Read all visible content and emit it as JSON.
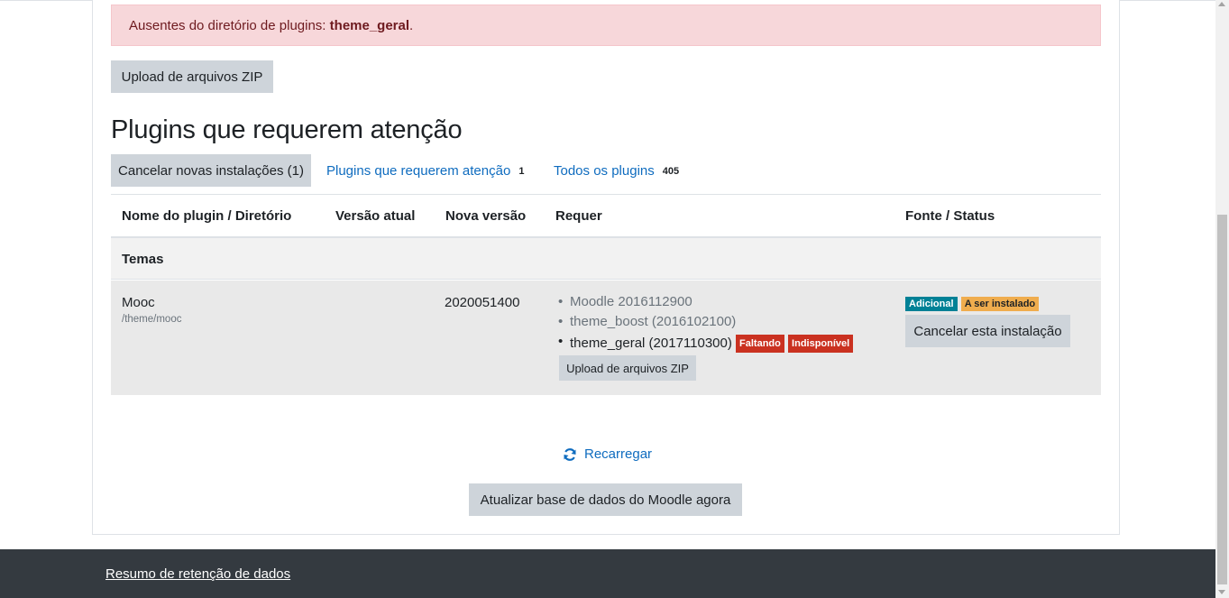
{
  "alert": {
    "text": "Ausentes do diretório de plugins: ",
    "plugin": "theme_geral",
    "suffix": "."
  },
  "upload_zip_label": "Upload de arquivos ZIP",
  "heading": "Plugins que requerem atenção",
  "cancel_new_label": "Cancelar novas instalações (1)",
  "nav": {
    "attention_label": "Plugins que requerem atenção",
    "attention_count": "1",
    "all_label": "Todos os plugins",
    "all_count": "405"
  },
  "table": {
    "headers": [
      "Nome do plugin / Diretório",
      "Versão atual",
      "Nova versão",
      "Requer",
      "Fonte / Status"
    ],
    "group": "Temas",
    "row": {
      "name": "Mooc",
      "dir": "/theme/mooc",
      "current_version": "",
      "new_version": "2020051400",
      "requires": [
        {
          "text": "Moodle 2016112900"
        },
        {
          "text": "theme_boost (2016102100)"
        },
        {
          "text": "theme_geral (2017110300)",
          "badges": [
            "Faltando",
            "Indisponível"
          ]
        }
      ],
      "upload_label": "Upload de arquivos ZIP",
      "status_tags": [
        "Adicional",
        "A ser instalado"
      ],
      "cancel_label": "Cancelar esta instalação"
    }
  },
  "reload_label": "Recarregar",
  "update_label": "Atualizar base de dados do Moodle agora",
  "footer_link": "Resumo de retenção de dados",
  "colors": {
    "link": "#0f6cbf",
    "danger": "#ca3120",
    "info": "#008196",
    "warning": "#f0ad4e",
    "footer": "#343a40"
  }
}
